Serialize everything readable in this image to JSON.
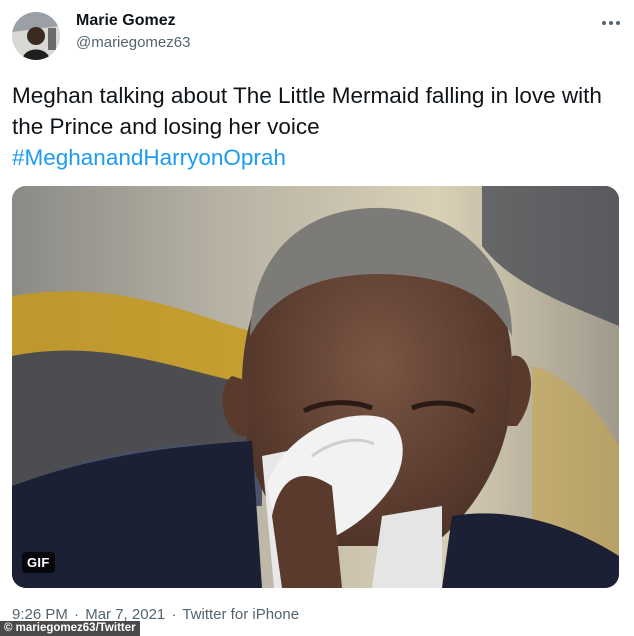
{
  "author": {
    "name": "Marie Gomez",
    "handle": "@mariegomez63",
    "avatar_icon": "profile-photo"
  },
  "menu": {
    "icon": "more-horizontal-icon"
  },
  "tweet": {
    "text": "Meghan talking about The Little Mermaid falling in love with the Prince and losing her voice",
    "hashtag": "#MeghanandHarryonOprah"
  },
  "media": {
    "badge": "GIF"
  },
  "meta": {
    "time": "9:26 PM",
    "separator": "·",
    "date": "Mar 7, 2021",
    "source": "Twitter for iPhone"
  },
  "credit": "© mariegomez63/Twitter",
  "colors": {
    "text": "#0f1419",
    "secondary": "#536471",
    "link": "#1d9bf0"
  }
}
